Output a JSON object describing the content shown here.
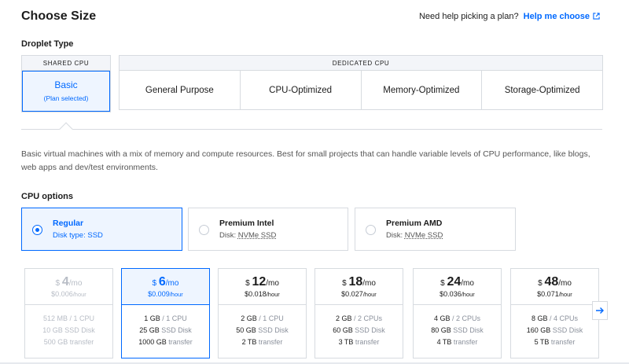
{
  "title": "Choose Size",
  "help": {
    "prompt": "Need help picking a plan?",
    "link": "Help me choose"
  },
  "droplet_type": {
    "label": "Droplet Type",
    "shared_header": "SHARED CPU",
    "basic_label": "Basic",
    "basic_sub": "(Plan selected)",
    "dedicated_header": "DEDICATED CPU",
    "dedicated": [
      "General Purpose",
      "CPU-Optimized",
      "Memory-Optimized",
      "Storage-Optimized"
    ]
  },
  "description": "Basic virtual machines with a mix of memory and compute resources. Best for small projects that can handle variable levels of CPU performance, like blogs, web apps and dev/test environments.",
  "cpu_options": {
    "label": "CPU options",
    "options": [
      {
        "name": "Regular",
        "disk_label": "Disk type:",
        "disk": "SSD",
        "selected": true
      },
      {
        "name": "Premium Intel",
        "disk_label": "Disk:",
        "disk": "NVMe SSD",
        "selected": false
      },
      {
        "name": "Premium AMD",
        "disk_label": "Disk:",
        "disk": "NVMe SSD",
        "selected": false
      }
    ]
  },
  "plans": [
    {
      "currency": "$",
      "amount": "4",
      "per": "/mo",
      "hourly": "$0.006",
      "hour_unit": "/hour",
      "mem": "512 MB",
      "cpu": "1 CPU",
      "disk": "10 GB",
      "disk_unit": "SSD Disk",
      "transfer": "500 GB",
      "transfer_unit": "transfer",
      "state": "disabled"
    },
    {
      "currency": "$",
      "amount": "6",
      "per": "/mo",
      "hourly": "$0.009",
      "hour_unit": "/hour",
      "mem": "1 GB",
      "cpu": "1 CPU",
      "disk": "25 GB",
      "disk_unit": "SSD Disk",
      "transfer": "1000 GB",
      "transfer_unit": "transfer",
      "state": "selected"
    },
    {
      "currency": "$",
      "amount": "12",
      "per": "/mo",
      "hourly": "$0.018",
      "hour_unit": "/hour",
      "mem": "2 GB",
      "cpu": "1 CPU",
      "disk": "50 GB",
      "disk_unit": "SSD Disk",
      "transfer": "2 TB",
      "transfer_unit": "transfer",
      "state": "normal"
    },
    {
      "currency": "$",
      "amount": "18",
      "per": "/mo",
      "hourly": "$0.027",
      "hour_unit": "/hour",
      "mem": "2 GB",
      "cpu": "2 CPUs",
      "disk": "60 GB",
      "disk_unit": "SSD Disk",
      "transfer": "3 TB",
      "transfer_unit": "transfer",
      "state": "normal"
    },
    {
      "currency": "$",
      "amount": "24",
      "per": "/mo",
      "hourly": "$0.036",
      "hour_unit": "/hour",
      "mem": "4 GB",
      "cpu": "2 CPUs",
      "disk": "80 GB",
      "disk_unit": "SSD Disk",
      "transfer": "4 TB",
      "transfer_unit": "transfer",
      "state": "normal"
    },
    {
      "currency": "$",
      "amount": "48",
      "per": "/mo",
      "hourly": "$0.071",
      "hour_unit": "/hour",
      "mem": "8 GB",
      "cpu": "4 CPUs",
      "disk": "160 GB",
      "disk_unit": "SSD Disk",
      "transfer": "5 TB",
      "transfer_unit": "transfer",
      "state": "normal"
    }
  ],
  "icons": {
    "external": "external-link-icon",
    "next": "arrow-right-icon",
    "accent": "#0069ff"
  }
}
